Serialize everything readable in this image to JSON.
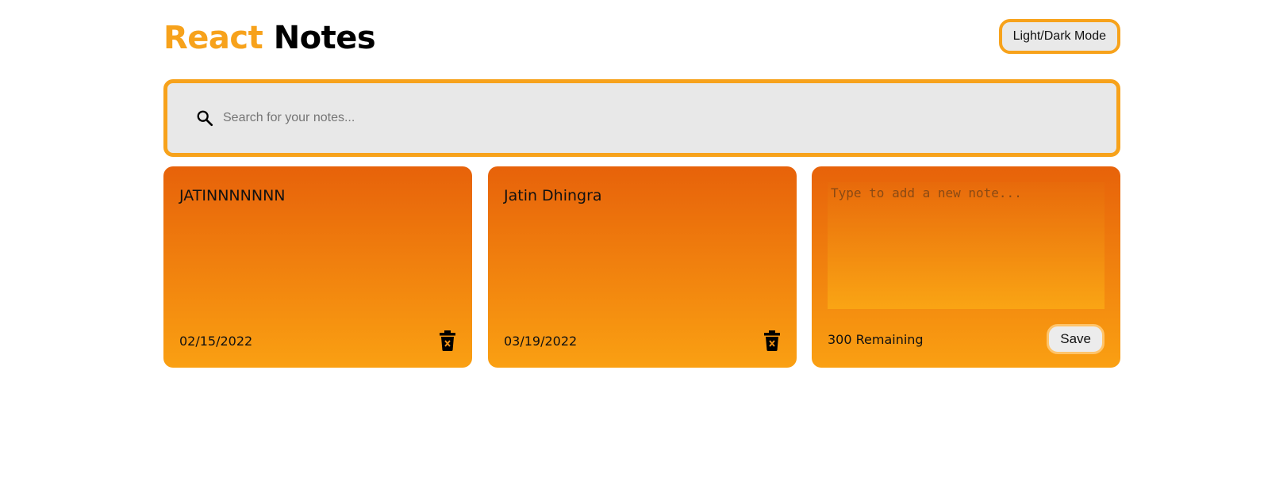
{
  "header": {
    "title_accent": "React",
    "title_rest": "Notes",
    "mode_button_label": "Light/Dark Mode"
  },
  "search": {
    "placeholder": "Search for your notes...",
    "value": "",
    "icon": "search-icon"
  },
  "notes": [
    {
      "text": "JATINNNNNNN",
      "date": "02/15/2022",
      "delete_icon": "trash-icon"
    },
    {
      "text": "Jatin Dhingra",
      "date": "03/19/2022",
      "delete_icon": "trash-icon"
    }
  ],
  "new_note": {
    "placeholder": "Type to add a new note...",
    "value": "",
    "remaining_label": "300 Remaining",
    "save_label": "Save"
  },
  "colors": {
    "accent": "#F7A21B",
    "note_gradient_top": "#E7620A",
    "note_gradient_bottom": "#FAA012"
  }
}
